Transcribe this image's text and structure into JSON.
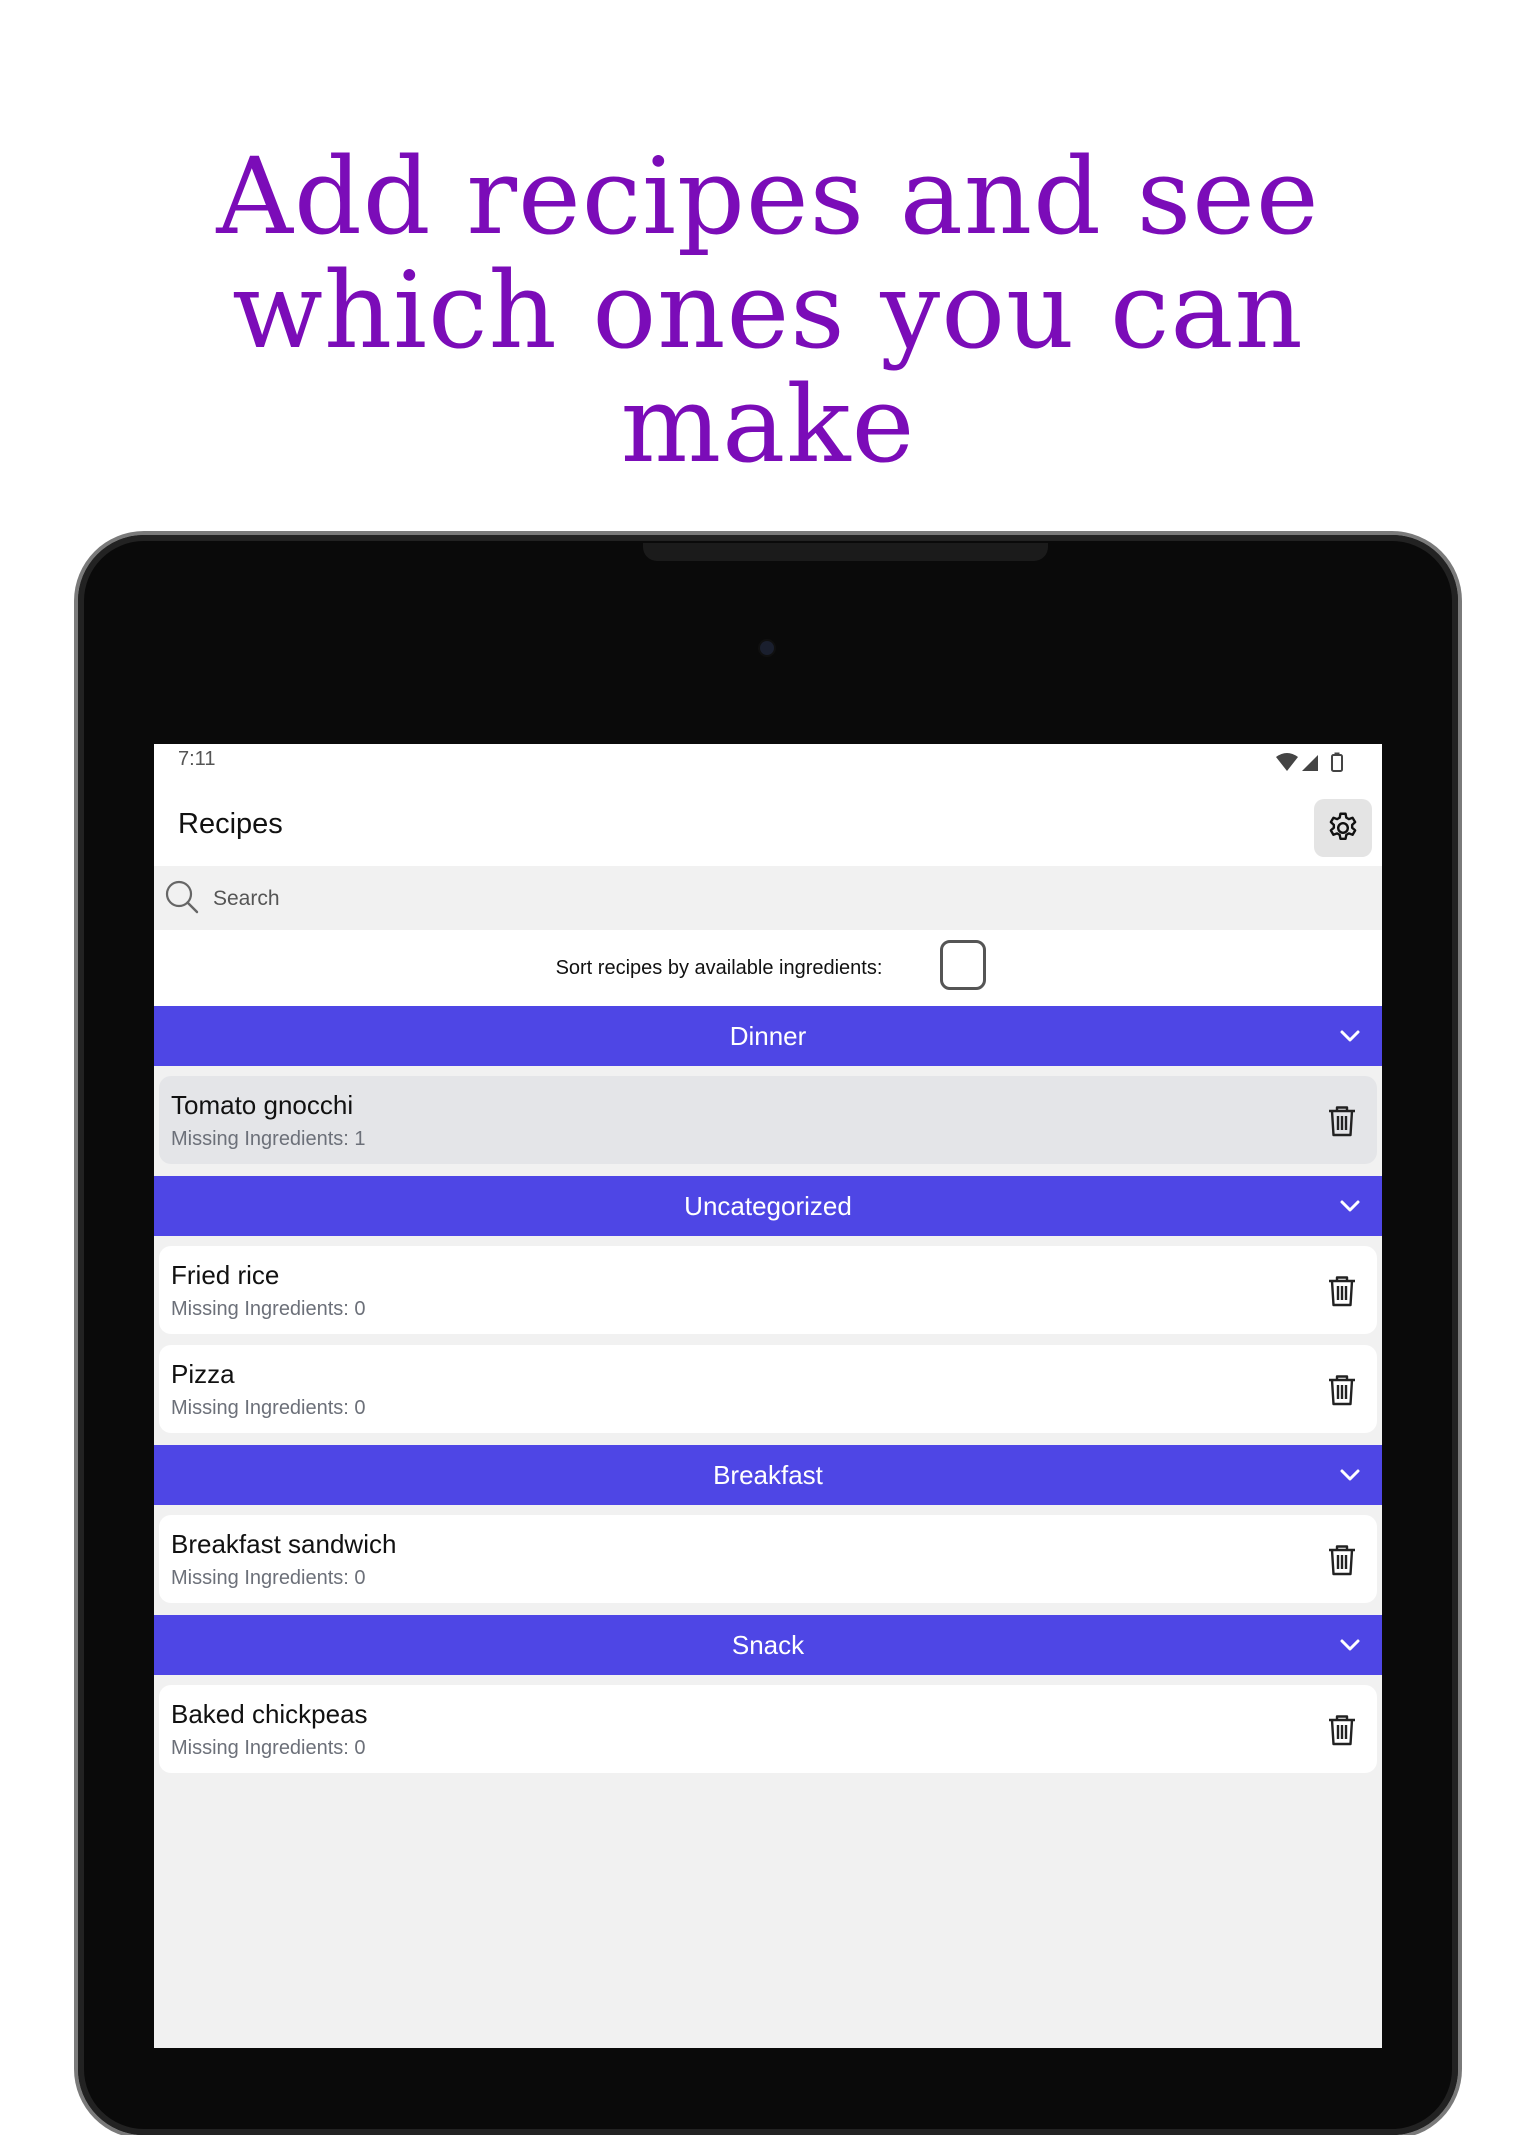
{
  "headline": {
    "lines": [
      "Add recipes and see",
      "which ones you can",
      "make"
    ]
  },
  "status_bar": {
    "time": "7:11"
  },
  "app_bar": {
    "title": "Recipes",
    "settings_icon": "gear-icon"
  },
  "search": {
    "placeholder": "Search",
    "value": ""
  },
  "sort": {
    "label": "Sort recipes by available ingredients:",
    "checked": false
  },
  "colors": {
    "headline": "#7b0cb8",
    "category_header": "#4e46e5",
    "highlight_row": "#e4e5e8"
  },
  "categories": [
    {
      "name": "Dinner",
      "items": [
        {
          "name": "Tomato gnocchi",
          "missing": "Missing Ingredients: 1"
        }
      ]
    },
    {
      "name": "Uncategorized",
      "items": [
        {
          "name": "Fried rice",
          "missing": "Missing Ingredients: 0"
        },
        {
          "name": "Pizza",
          "missing": "Missing Ingredients: 0"
        }
      ]
    },
    {
      "name": "Breakfast",
      "items": [
        {
          "name": "Breakfast sandwich",
          "missing": "Missing Ingredients: 0"
        }
      ]
    },
    {
      "name": "Snack",
      "items": [
        {
          "name": "Baked chickpeas",
          "missing": "Missing Ingredients: 0"
        }
      ]
    }
  ]
}
